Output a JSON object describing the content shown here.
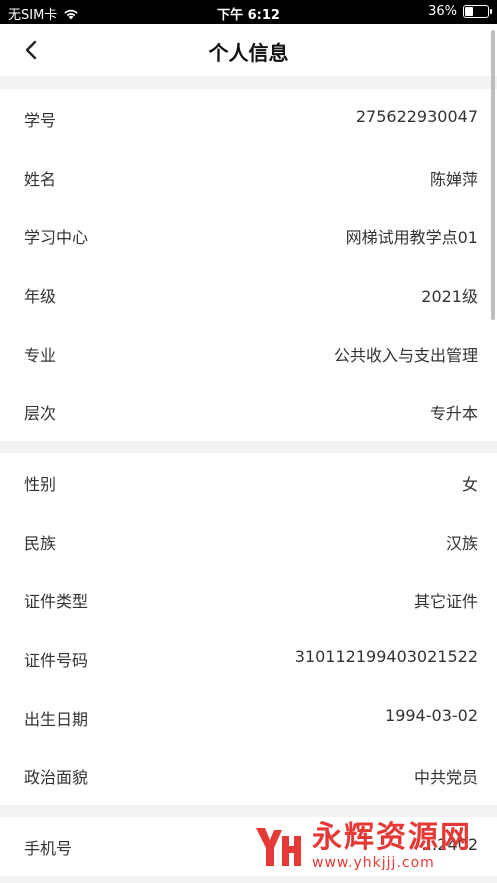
{
  "status_bar": {
    "carrier": "无SIM卡",
    "time": "下午 6:12",
    "battery": "36%",
    "battery_level": 0.36
  },
  "nav": {
    "title": "个人信息",
    "back_icon": "chevron-left-icon"
  },
  "section1": [
    {
      "label": "学号",
      "value": "275622930047"
    },
    {
      "label": "姓名",
      "value": "陈婵萍"
    },
    {
      "label": "学习中心",
      "value": "网梯试用教学点01"
    },
    {
      "label": "年级",
      "value": "2021级"
    },
    {
      "label": "专业",
      "value": "公共收入与支出管理"
    },
    {
      "label": "层次",
      "value": "专升本"
    }
  ],
  "section2": [
    {
      "label": "性别",
      "value": "女"
    },
    {
      "label": "民族",
      "value": "汉族"
    },
    {
      "label": "证件类型",
      "value": "其它证件"
    },
    {
      "label": "证件号码",
      "value": "310112199403021522"
    },
    {
      "label": "出生日期",
      "value": "1994-03-02"
    },
    {
      "label": "政治面貌",
      "value": "中共党员"
    }
  ],
  "section3": [
    {
      "label": "手机号",
      "value": "…2402"
    }
  ],
  "watermark": {
    "text": "永辉资源网",
    "url": "www.yhkjjj.com",
    "color": "#e53935"
  }
}
